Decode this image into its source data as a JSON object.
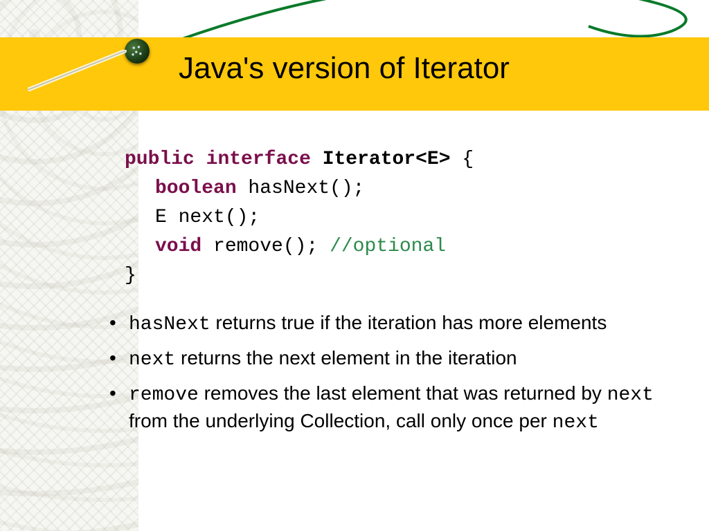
{
  "title": "Java's version of Iterator",
  "code": {
    "l1_kw1": "public",
    "l1_kw2": "interface",
    "l1_cls": "Iterator<E>",
    "l1_brace": " {",
    "l2_kw": "boolean",
    "l2_rest": " hasNext();",
    "l3": "E next();",
    "l4_kw": "void",
    "l4_rest": " remove(); ",
    "l4_cmt": "//optional",
    "l5": "}"
  },
  "bullets": [
    {
      "code": "hasNext",
      "text": " returns true if the iteration has more elements"
    },
    {
      "code": "next",
      "text": " returns the next element in the iteration"
    },
    {
      "code": "remove",
      "text_a": " removes the last element that was returned by ",
      "code2": "next",
      "text_b": " from the underlying Collection, call only once per ",
      "code3": "next"
    }
  ]
}
